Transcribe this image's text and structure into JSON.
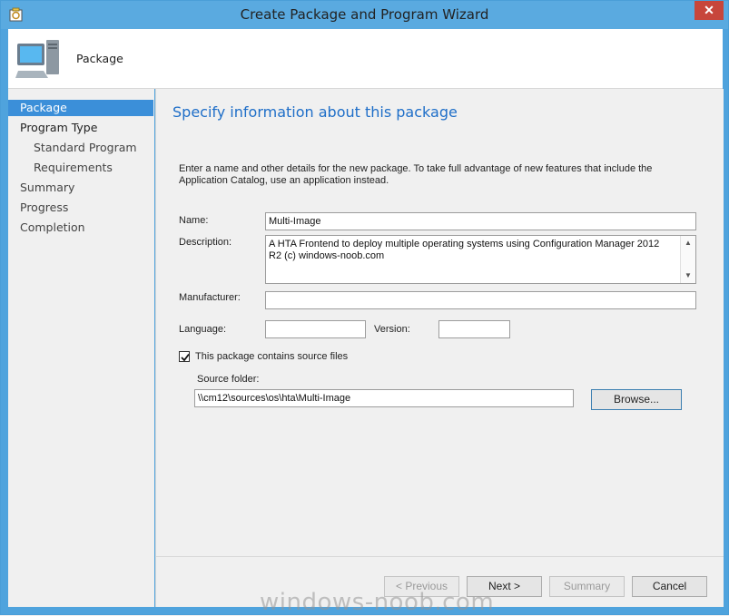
{
  "window": {
    "title": "Create Package and Program Wizard"
  },
  "header": {
    "title": "Package"
  },
  "sidebar": {
    "items": [
      {
        "label": "Package"
      },
      {
        "label": "Program Type"
      },
      {
        "label": "Standard Program"
      },
      {
        "label": "Requirements"
      },
      {
        "label": "Summary"
      },
      {
        "label": "Progress"
      },
      {
        "label": "Completion"
      }
    ],
    "active_index": 0
  },
  "content": {
    "heading": "Specify information about this package",
    "intro": "Enter a name and other details for the new package. To take full advantage of new features that include the Application Catalog, use an application instead."
  },
  "form": {
    "name_label": "Name:",
    "name_value": "Multi-Image",
    "description_label": "Description:",
    "description_value": "A HTA Frontend to deploy multiple operating systems using Configuration Manager 2012 R2 (c) windows-noob.com",
    "manufacturer_label": "Manufacturer:",
    "manufacturer_value": "",
    "language_label": "Language:",
    "language_value": "",
    "version_label": "Version:",
    "version_value": "",
    "source_checkbox_label": "This package contains source files",
    "source_checkbox_checked": true,
    "source_folder_label": "Source folder:",
    "source_folder_value": "\\\\cm12\\sources\\os\\hta\\Multi-Image",
    "browse_label": "Browse..."
  },
  "buttons": {
    "previous": "< Previous",
    "next": "Next >",
    "summary": "Summary",
    "cancel": "Cancel"
  },
  "watermark": "windows-noob.com",
  "colors": {
    "accent": "#1e6ec8",
    "active_nav": "#3b8fd9",
    "titlebar": "#5aaae0",
    "close": "#c7463b"
  }
}
